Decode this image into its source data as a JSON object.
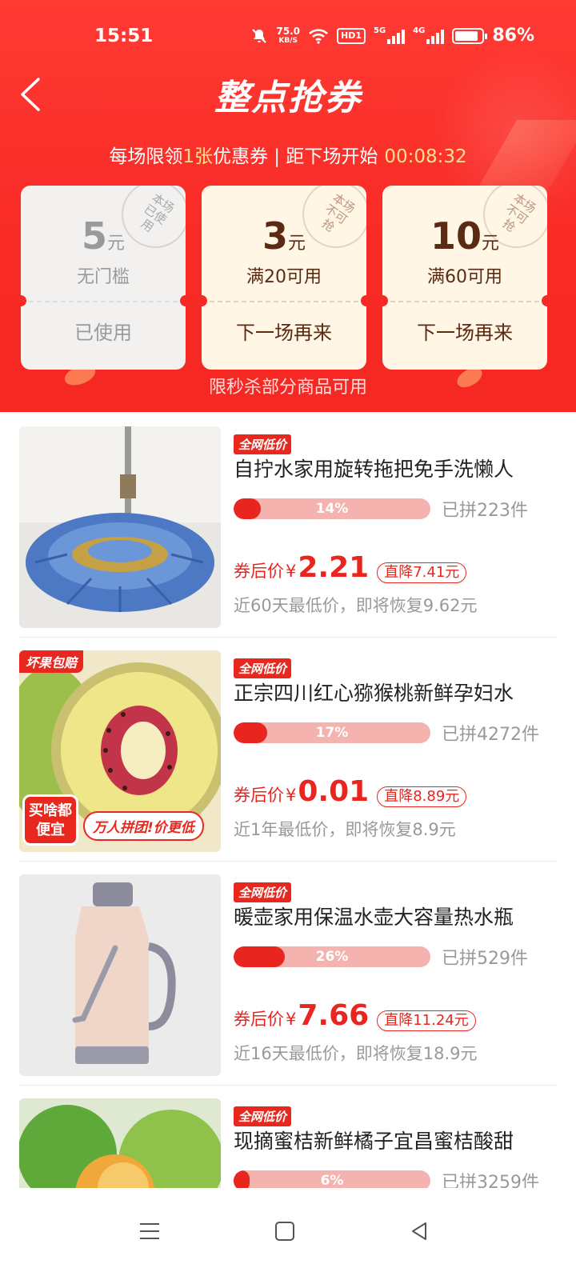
{
  "status_bar": {
    "time": "15:51",
    "net_speed_value": "75.0",
    "net_speed_unit": "KB/S",
    "hd_label": "HD1",
    "sim1_tag": "5G",
    "sim2_tag": "4G",
    "battery_level": 0.86,
    "battery_text": "86%",
    "icons": [
      "mute-icon",
      "wifi-icon",
      "hd-icon",
      "signal-5g-icon",
      "signal-4g-icon",
      "battery-icon"
    ]
  },
  "header": {
    "title": "整点抢券",
    "subtitle_prefix": "每场限领",
    "subtitle_count": "1张",
    "subtitle_suffix": "优惠券 | 距下场开始",
    "countdown": "00:08:32",
    "limit_note": "限秒杀部分商品可用"
  },
  "coupons": [
    {
      "amount": "5",
      "unit": "元",
      "condition": "无门槛",
      "action": "已使用",
      "stamp": "本场已使用",
      "used": true
    },
    {
      "amount": "3",
      "unit": "元",
      "condition": "满20可用",
      "action": "下一场再来",
      "stamp": "本场不可抢",
      "used": false
    },
    {
      "amount": "10",
      "unit": "元",
      "condition": "满60可用",
      "action": "下一场再来",
      "stamp": "本场不可抢",
      "used": false
    }
  ],
  "products": [
    {
      "tag": "全网低价",
      "title": "自拧水家用旋转拖把免手洗懒人",
      "progress": 0.14,
      "progress_text": "14%",
      "joined": "已拼223件",
      "price_label": "券后价",
      "currency": "¥",
      "price": "2.21",
      "drop": "直降7.41元",
      "history": "近60天最低价，即将恢复9.62元",
      "image": "mop-image"
    },
    {
      "tag": "全网低价",
      "title": "正宗四川红心猕猴桃新鲜孕妇水",
      "progress": 0.17,
      "progress_text": "17%",
      "joined": "已拼4272件",
      "price_label": "券后价",
      "currency": "¥",
      "price": "0.01",
      "drop": "直降8.89元",
      "history": "近1年最低价，即将恢复8.9元",
      "image": "kiwi-image",
      "image_badge": "坏果包赔",
      "promo_a": "买啥都便宜",
      "promo_b": "万人拼团!价更低"
    },
    {
      "tag": "全网低价",
      "title": "暖壶家用保温水壶大容量热水瓶",
      "progress": 0.26,
      "progress_text": "26%",
      "joined": "已拼529件",
      "price_label": "券后价",
      "currency": "¥",
      "price": "7.66",
      "drop": "直降11.24元",
      "history": "近16天最低价，即将恢复18.9元",
      "image": "thermos-image"
    },
    {
      "tag": "全网低价",
      "title": "现摘蜜桔新鲜橘子宜昌蜜桔酸甜",
      "progress": 0.06,
      "progress_text": "6%",
      "joined": "已拼3259件",
      "image": "orange-image"
    }
  ],
  "nav": {
    "icons": [
      "menu-icon",
      "home-icon",
      "back-triangle-icon"
    ]
  },
  "colors": {
    "brand_red": "#f62a24",
    "price_red": "#e8261f",
    "highlight_yellow": "#ffe08a"
  }
}
